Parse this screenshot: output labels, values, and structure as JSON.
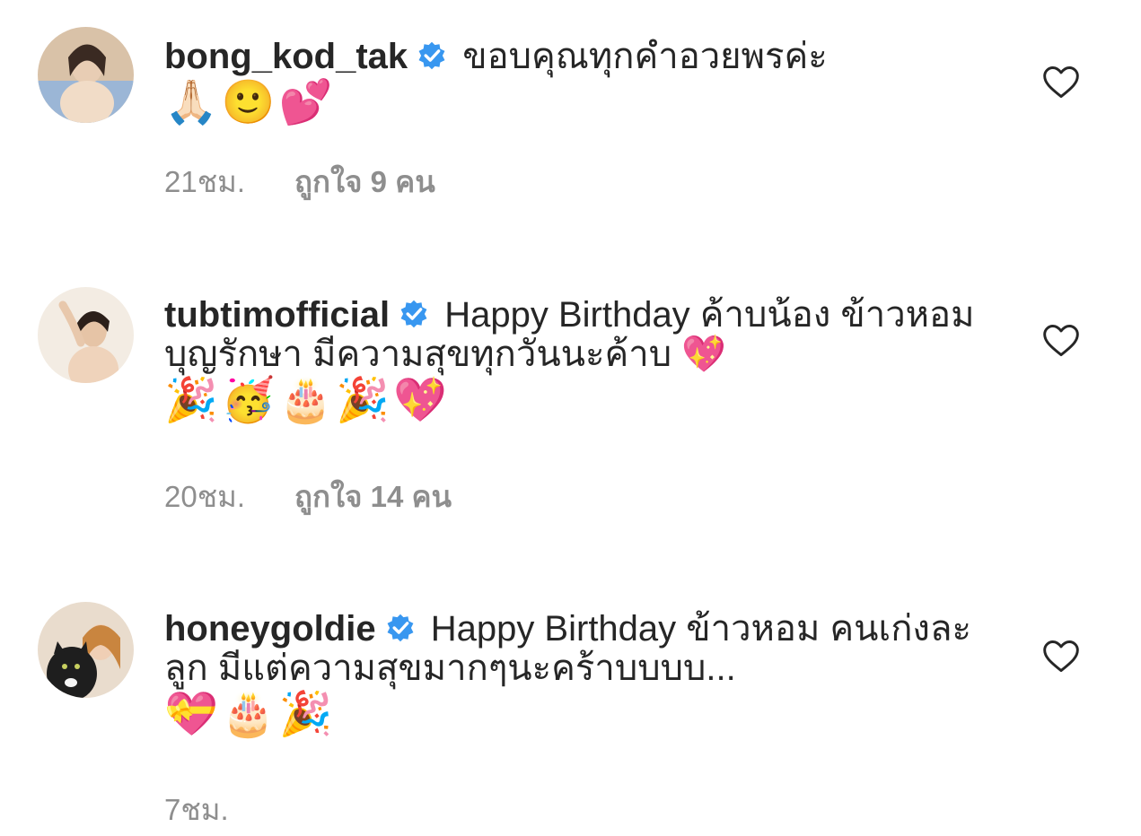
{
  "comments": [
    {
      "username": "bong_kod_tak",
      "text": "ขอบคุณทุกคำอวยพรค่ะ",
      "emojis": "🙏🏻🙂💕",
      "time": "21ชม.",
      "likes": "ถูกใจ 9 คน"
    },
    {
      "username": "tubtimofficial",
      "text": "Happy Birthday ค้าบน้อง ข้าวหอม บุญรักษา มีความสุขทุกวันนะค้าบ 💖",
      "emojis": "🎉🥳🎂🎉💖",
      "time": "20ชม.",
      "likes": "ถูกใจ 14 คน"
    },
    {
      "username": "honeygoldie",
      "text": "Happy Birthday ข้าวหอม คนเก่งละลูก มีแต่ความสุขมากๆนะคร้าบบบบ...",
      "emojis": "💝🎂🎉",
      "time": "7ชม.",
      "likes": ""
    }
  ],
  "colors": {
    "text": "#262626",
    "meta": "#8e8e8e",
    "verified": "#3897f0",
    "heart_outline": "#262626"
  },
  "icons": {
    "verified": "verified-badge-icon",
    "like": "heart-outline-icon"
  }
}
